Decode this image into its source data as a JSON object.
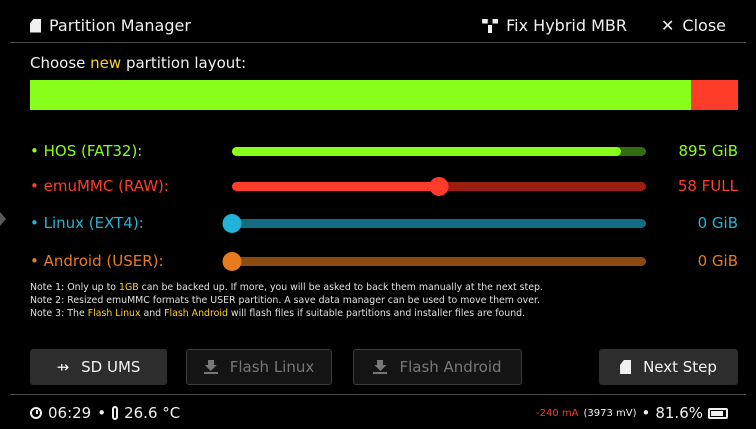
{
  "header": {
    "title": "Partition Manager",
    "fix_hybrid_label": "Fix Hybrid MBR",
    "close_label": "Close"
  },
  "choose": {
    "prefix": "Choose ",
    "highlight": "new",
    "suffix": " partition layout:"
  },
  "layout_bar": {
    "fill_fraction": 0.934,
    "fill_color": "#88ff1a",
    "rest_color": "#ff3b2a"
  },
  "partitions": [
    {
      "label": "• HOS (FAT32):",
      "value": "895 GiB",
      "color": "#88ff1a",
      "track": "#336b10",
      "fraction": 0.94,
      "knob": false
    },
    {
      "label": "• emuMMC (RAW):",
      "value": "58 FULL",
      "color": "#ff3b2a",
      "track": "#9a1e12",
      "fraction": 0.5,
      "knob": true
    },
    {
      "label": "• Linux (EXT4):",
      "value": "0 GiB",
      "color": "#22b4d8",
      "track": "#136b84",
      "fraction": 0.0,
      "knob": true
    },
    {
      "label": "• Android (USER):",
      "value": "0 GiB",
      "color": "#e87a1e",
      "track": "#8a4a10",
      "fraction": 0.0,
      "knob": true
    }
  ],
  "notes": {
    "n1_a": "Note 1: Only up to ",
    "n1_hl": "1GB",
    "n1_b": " can be backed up. If more, you will be asked to back them manually at the next step.",
    "n2": "Note 2: Resized emuMMC formats the USER partition. A save data manager can be used to move them over.",
    "n3_a": "Note 3: The ",
    "n3_hl1": "Flash Linux",
    "n3_b": " and ",
    "n3_hl2": "Flash Android",
    "n3_c": " will flash files if suitable partitions and installer files are found."
  },
  "buttons": {
    "sd_ums": "SD UMS",
    "flash_linux": "Flash Linux",
    "flash_android": "Flash Android",
    "next_step": "Next Step"
  },
  "footer": {
    "time": "06:29",
    "sep": "•",
    "temp": "26.6 °C",
    "current": "-240 mA",
    "voltage": "(3973 mV)",
    "battery": "81.6%"
  },
  "icons": {
    "sd": "sd-card-icon",
    "network": "network-icon",
    "close": "close-icon",
    "usb": "usb-icon",
    "download": "download-icon",
    "clock": "clock-icon",
    "thermometer": "thermometer-icon",
    "battery": "battery-icon"
  }
}
